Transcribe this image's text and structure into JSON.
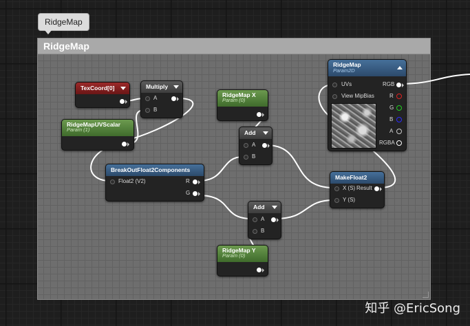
{
  "comment": {
    "tab_label": "RidgeMap",
    "title": "RidgeMap"
  },
  "nodes": {
    "texcoord": {
      "title": "TexCoord[0]"
    },
    "multiply": {
      "title": "Multiply",
      "pin_a": "A",
      "pin_b": "B"
    },
    "uvscalar": {
      "title": "RidgeMapUVScalar",
      "subtitle": "Param (1)"
    },
    "ridgemap_x": {
      "title": "RidgeMap X",
      "subtitle": "Param (0)"
    },
    "add_top": {
      "title": "Add",
      "pin_a": "A",
      "pin_b": "B"
    },
    "breakout": {
      "title": "BreakOutFloat2Components",
      "pin_in": "Float2 (V2)",
      "pin_r": "R",
      "pin_g": "G"
    },
    "ridgemap_tex": {
      "title": "RidgeMap",
      "subtitle": "Param2D",
      "pin_uvs": "UVs",
      "pin_mipbias": "View MipBias",
      "out_rgb": "RGB",
      "out_r": "R",
      "out_g": "G",
      "out_b": "B",
      "out_a": "A",
      "out_rgba": "RGBA"
    },
    "makefloat2": {
      "title": "MakeFloat2",
      "pin_x": "X (S)",
      "pin_y": "Y (S)",
      "out_result": "Result"
    },
    "add_bottom": {
      "title": "Add",
      "pin_a": "A",
      "pin_b": "B"
    },
    "ridgemap_y": {
      "title": "RidgeMap Y",
      "subtitle": "Param (0)"
    }
  },
  "watermark": "知乎 @EricSong",
  "colors": {
    "pin_red": "#e02020",
    "pin_green": "#20d020",
    "pin_blue": "#2a2aff",
    "pin_alpha": "#cccccc",
    "wire": "#ffffff"
  }
}
